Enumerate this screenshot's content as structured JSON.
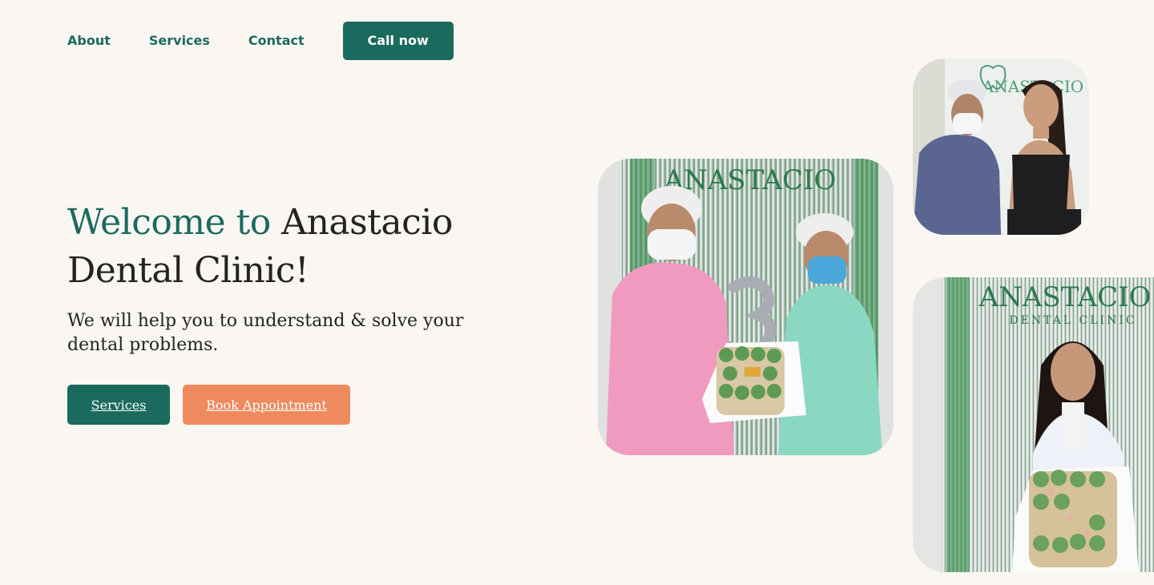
{
  "nav": {
    "links": [
      "About",
      "Services",
      "Contact"
    ],
    "call_label": "Call now"
  },
  "hero": {
    "title_accent": "Welcome to",
    "title_rest_line1": " Anastacio",
    "title_line2": "Dental Clinic!",
    "subtitle": "We will help you to understand & solve your dental problems.",
    "services_btn": "Services",
    "book_btn": "Book Appointment"
  },
  "photos": {
    "sign_text": "ANASTACIO",
    "sign_sub": "DENTAL CLINIC"
  },
  "colors": {
    "background": "#faf7f3",
    "brand_green": "#1b6a5e",
    "accent_orange": "#ee8a5e",
    "text": "#232323"
  }
}
